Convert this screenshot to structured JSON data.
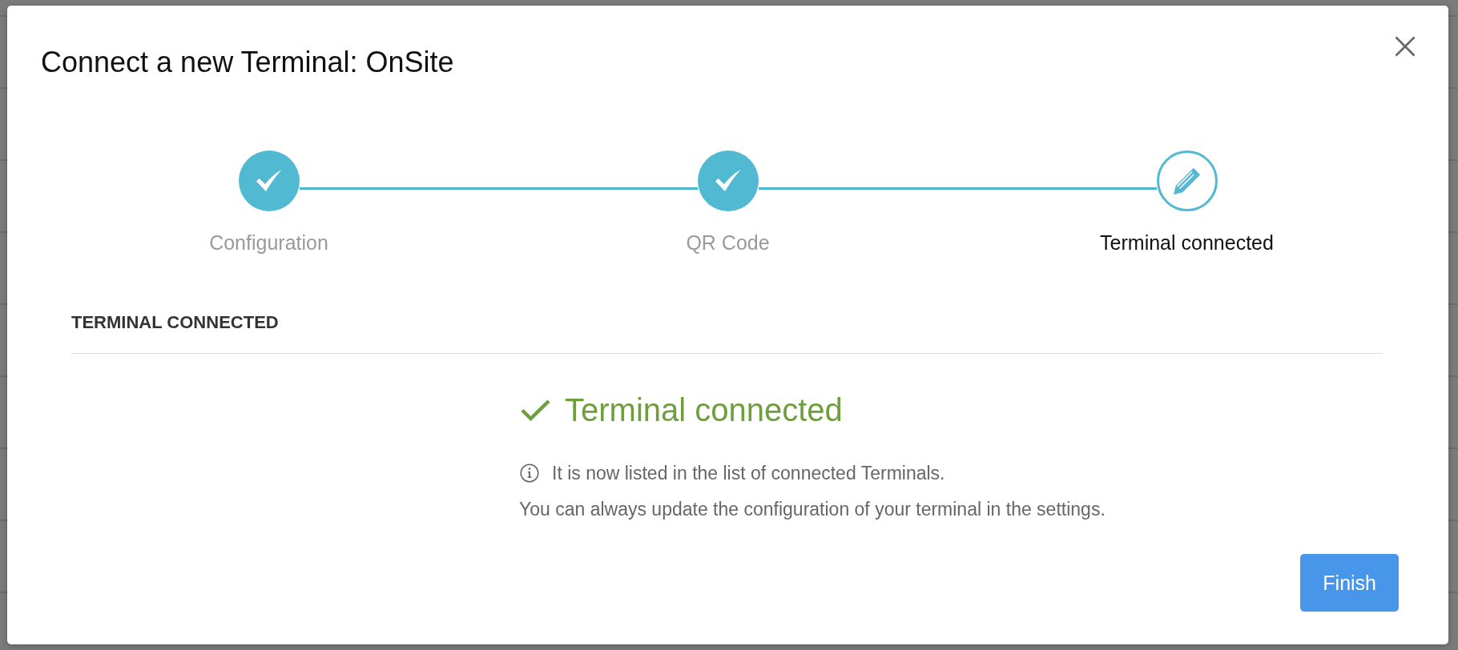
{
  "dialog": {
    "title": "Connect a new Terminal: OnSite"
  },
  "stepper": {
    "steps": [
      {
        "label": "Configuration",
        "completed": true,
        "selected": false
      },
      {
        "label": "QR Code",
        "completed": true,
        "selected": false
      },
      {
        "label": "Terminal connected",
        "completed": false,
        "selected": true
      }
    ]
  },
  "section": {
    "heading": "TERMINAL CONNECTED"
  },
  "result": {
    "title": "Terminal connected"
  },
  "messages": [
    {
      "kind": "info",
      "text": "It is now listed in the list of connected Terminals."
    },
    {
      "kind": "plain",
      "text": "You can always update the configuration of your terminal in the settings."
    }
  ],
  "buttons": [
    {
      "label": "Finish",
      "kind": "primary"
    }
  ]
}
